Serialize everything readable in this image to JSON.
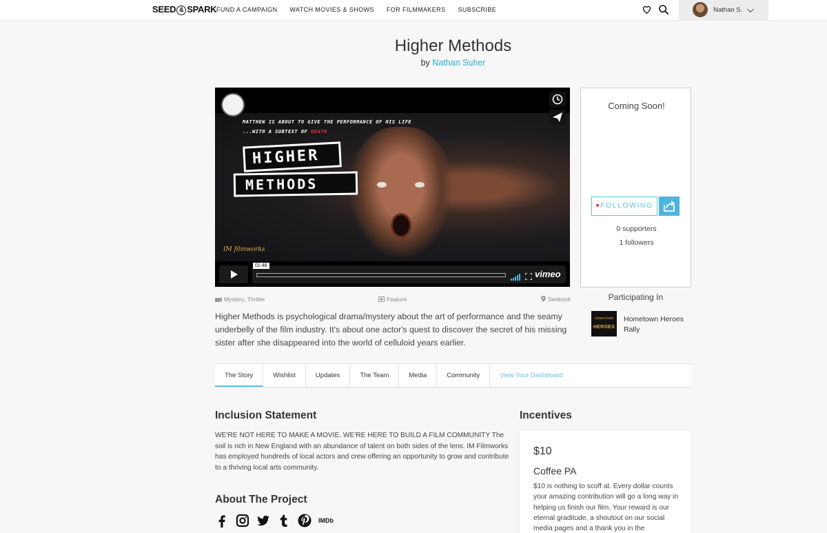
{
  "nav": {
    "logo_left": "SEED",
    "logo_amp": "&",
    "logo_right": "SPARK",
    "links": [
      "FUND A CAMPAIGN",
      "WATCH MOVIES & SHOWS",
      "FOR FILMMAKERS",
      "SUBSCRIBE"
    ],
    "user_name": "Nathan S."
  },
  "header": {
    "title": "Higher Methods",
    "by": "by",
    "author": "Nathan Suher"
  },
  "video": {
    "tagline_1": "MATTHEW IS ABOUT TO GIVE THE PERFORMANCE OF HIS LIFE",
    "tagline_2": "...WITH A SUBTEXT OF",
    "tagline_death": "DEATH",
    "title_line_1": "HIGHER",
    "title_line_2": "METHODS",
    "brand": "IM filmworks",
    "timecode": "01:48",
    "player_brand": "vimeo"
  },
  "meta": {
    "genre": "Mystery, Thriller",
    "format": "Feature",
    "location": "Seekonk"
  },
  "description": "Higher Methods is psychological drama/mystery about the art of performance and the seamy underbelly of the film industry. It's about one actor's quest to discover the secret of his missing sister after she disappeared into the world of celluloid years earlier.",
  "sidebar": {
    "status": "Coming Soon!",
    "follow_label": "FOLLOWING",
    "supporters": "0 supporters",
    "followers": "1 followers",
    "participating_heading": "Participating In",
    "rally_logo_sub": "HOMETOWN",
    "rally_logo_text": "HEROES",
    "rally_name": "Hometown Heroes Rally"
  },
  "tabs": [
    {
      "label": "The Story",
      "active": true
    },
    {
      "label": "Wishlist"
    },
    {
      "label": "Updates"
    },
    {
      "label": "The Team"
    },
    {
      "label": "Media"
    },
    {
      "label": "Community"
    },
    {
      "label": "View Your Dashboard",
      "link": true
    }
  ],
  "inclusion": {
    "heading": "Inclusion Statement",
    "body": "WE'RE NOT HERE TO MAKE A MOVIE. WE'RE HERE TO BUILD A FILM COMMUNITY The soil is rich in New England with an abundance of talent on both sides of the lens. IM Filmworks has employed hundreds of local actors and crew offering an opportunity to grow and contribute to a thriving local arts community."
  },
  "about": {
    "heading": "About The Project",
    "social_icons": [
      "facebook-icon",
      "instagram-icon",
      "twitter-icon",
      "tumblr-icon",
      "pinterest-icon",
      "imdb-icon"
    ],
    "imdb_label": "IMDb"
  },
  "incentives": {
    "heading": "Incentives",
    "price": "$10",
    "name": "Coffee PA",
    "desc": "$10 is nothing to scoff at.  Every dollar counts your amazing contribution will go a long way in helping us finish our film.  Your reward is our eternal graditude, a shoutout on our social media pages and a thank you in the"
  },
  "colors": {
    "accent": "#5bc3df",
    "heart": "#e2342a"
  }
}
